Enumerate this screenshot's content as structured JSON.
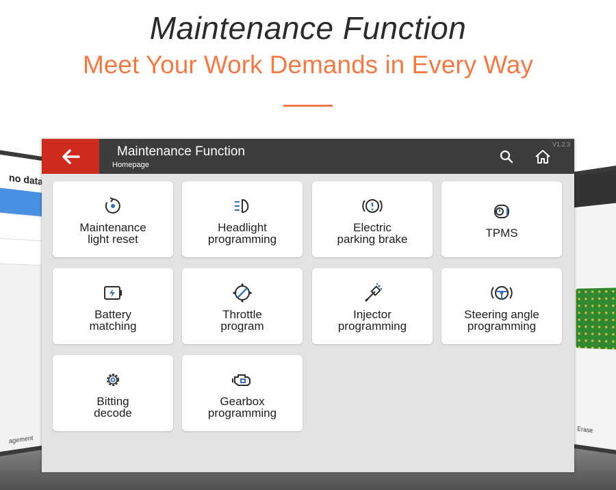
{
  "banner": {
    "headline": "Maintenance Function",
    "subheadline": "Meet Your Work Demands in Every Way"
  },
  "side_left": {
    "header_fragment": "no data to",
    "footer_fragment": "agement"
  },
  "side_right": {
    "footer_fragment": "Erase"
  },
  "topbar": {
    "title": "Maintenance Function",
    "breadcrumb": "Homepage",
    "version": "V1.2.3",
    "back_icon": "arrow-left-icon",
    "search_icon": "search-icon",
    "home_icon": "home-icon"
  },
  "colors": {
    "accent_orange": "#f07a45",
    "back_red": "#cd2b1f",
    "topbar": "#3c3c3c",
    "icon_blue": "#3a6fb5"
  },
  "tiles": [
    {
      "label": "Maintenance\nlight reset",
      "icon": "reset-arrow-icon"
    },
    {
      "label": "Headlight\nprogramming",
      "icon": "headlight-icon"
    },
    {
      "label": "Electric\nparking brake",
      "icon": "parking-brake-icon"
    },
    {
      "label": "TPMS",
      "icon": "tire-pressure-icon"
    },
    {
      "label": "Battery\nmatching",
      "icon": "battery-icon"
    },
    {
      "label": "Throttle\nprogram",
      "icon": "throttle-icon"
    },
    {
      "label": "Injector\nprogramming",
      "icon": "injector-icon"
    },
    {
      "label": "Steering angle\nprogramming",
      "icon": "steering-wheel-icon"
    },
    {
      "label": "Bitting\ndecode",
      "icon": "gear-icon"
    },
    {
      "label": "Gearbox\nprogramming",
      "icon": "engine-icon"
    }
  ]
}
